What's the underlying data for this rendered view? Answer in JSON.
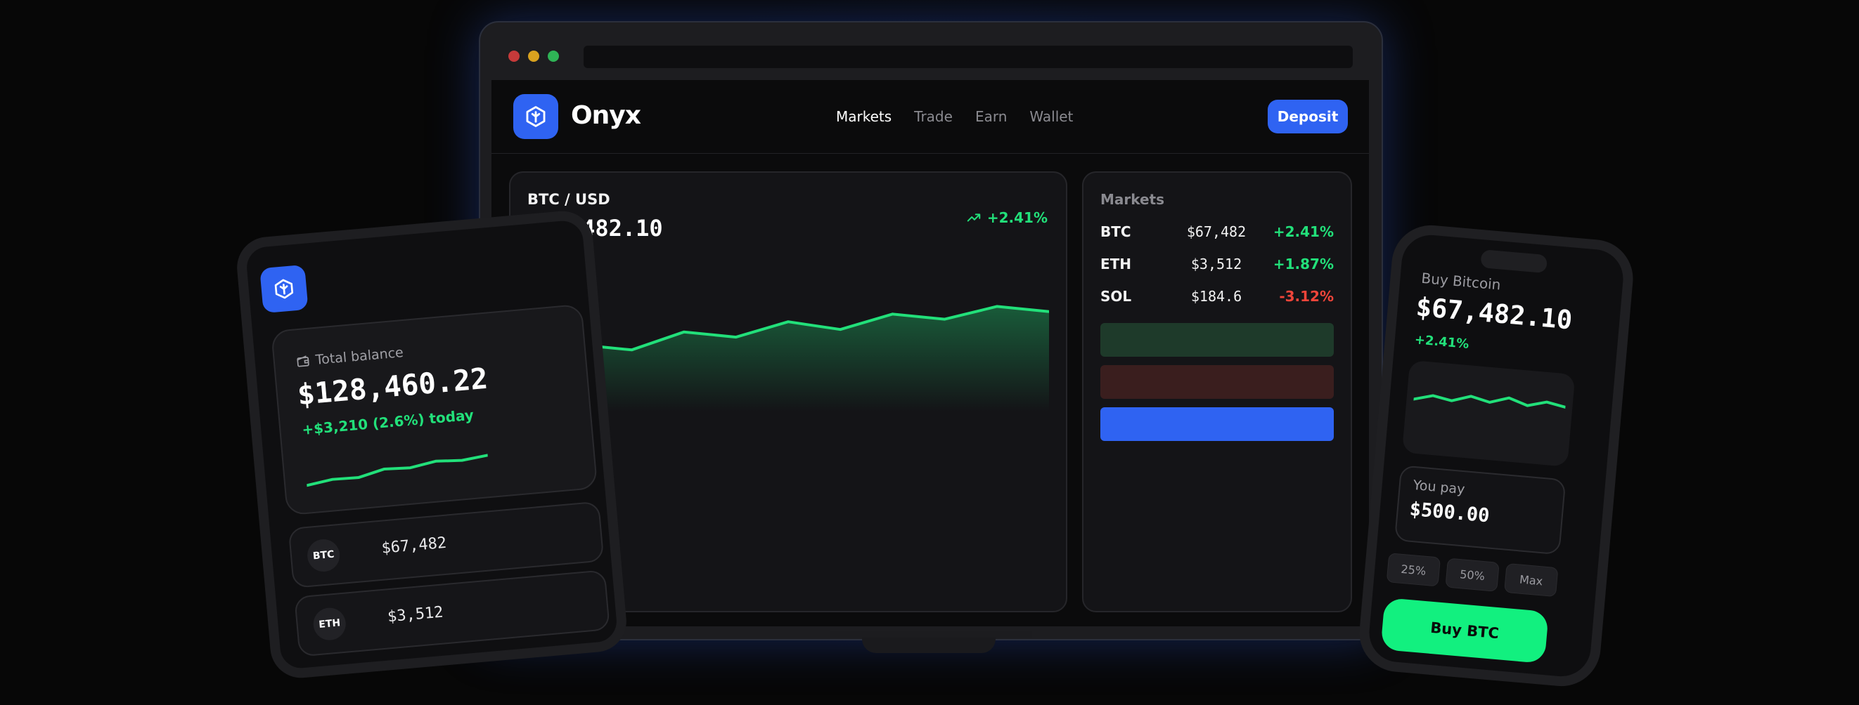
{
  "colors": {
    "accent": "#2f63f2",
    "positive": "#22e07a",
    "negative": "#f0453a",
    "buy": "#12f07f"
  },
  "desktop": {
    "brand": "Onyx",
    "logo_icon": "hexagon-logo-icon",
    "nav": {
      "items": [
        "Markets",
        "Trade",
        "Earn",
        "Wallet"
      ],
      "active": "Markets"
    },
    "deposit_label": "Deposit",
    "chart_card": {
      "pair": "BTC / USD",
      "price": "$67,482.10",
      "change": "+2.41%",
      "change_icon": "trending-up-icon"
    },
    "markets": {
      "title": "Markets",
      "rows": [
        {
          "symbol": "BTC",
          "price": "$67,482",
          "change": "+2.41%",
          "direction": "up"
        },
        {
          "symbol": "ETH",
          "price": "$3,512",
          "change": "+1.87%",
          "direction": "up"
        },
        {
          "symbol": "SOL",
          "price": "$184.6",
          "change": "-3.12%",
          "direction": "down"
        }
      ],
      "placeholder_bars": [
        {
          "color": "#1e3a2a"
        },
        {
          "color": "#3a1e1e"
        },
        {
          "color": "#2f63f2"
        }
      ]
    }
  },
  "tablet": {
    "logo_icon": "hexagon-logo-icon",
    "balance_label": "Total balance",
    "balance_icon": "wallet-icon",
    "balance": "$128,460.22",
    "today": "+$3,210 (2.6%) today",
    "coins": [
      {
        "symbol": "BTC",
        "price": "$67,482"
      },
      {
        "symbol": "ETH",
        "price": "$3,512"
      }
    ]
  },
  "phone": {
    "title": "Buy Bitcoin",
    "price": "$67,482.10",
    "change": "+2.41%",
    "pay_label": "You pay",
    "pay_amount": "$500.00",
    "chips": [
      "25%",
      "50%",
      "Max"
    ],
    "buy_label": "Buy BTC"
  },
  "chart_data": [
    {
      "type": "area",
      "title": "BTC / USD",
      "x": [
        0,
        1,
        2,
        3,
        4,
        5,
        6,
        7,
        8,
        9,
        10
      ],
      "values": [
        44,
        50,
        46,
        60,
        56,
        68,
        62,
        74,
        70,
        80,
        76
      ],
      "ylim": [
        0,
        100
      ],
      "grid": false
    },
    {
      "type": "line",
      "values": [
        30,
        38,
        37,
        50,
        48,
        57,
        54,
        60
      ],
      "ylim": [
        0,
        100
      ],
      "grid": false
    },
    {
      "type": "line",
      "values": [
        50,
        62,
        54,
        68,
        58,
        72,
        58,
        70,
        62
      ],
      "ylim": [
        0,
        100
      ],
      "grid": false
    }
  ]
}
